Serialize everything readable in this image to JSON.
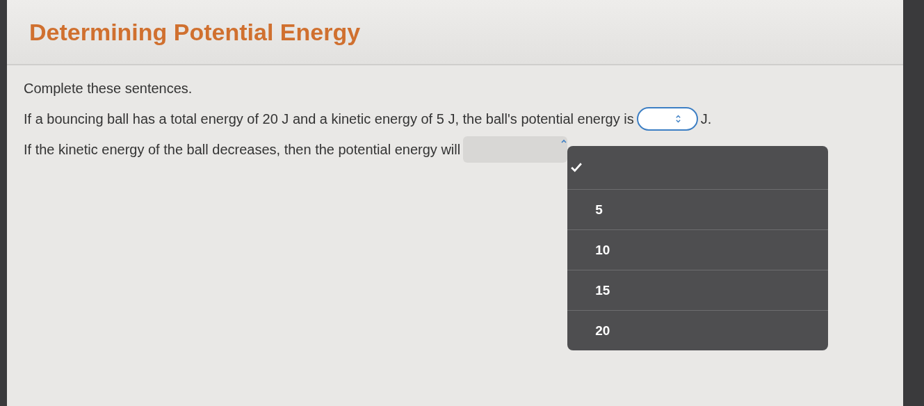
{
  "title": "Determining Potential Energy",
  "instructions": "Complete these sentences.",
  "sentences": [
    {
      "before": "If a bouncing ball has a total energy of 20 J and a kinetic energy of 5 J, the ball's potential energy is",
      "after": "J.",
      "dropdown": {
        "expanded": false
      }
    },
    {
      "before": "If the kinetic energy of the ball decreases, then the potential energy will",
      "dropdown": {
        "expanded": true
      }
    }
  ],
  "menu": {
    "blank_selected": true,
    "options": [
      {
        "label": "5",
        "selected": false
      },
      {
        "label": "10",
        "selected": false
      },
      {
        "label": "15",
        "selected": false
      },
      {
        "label": "20",
        "selected": false
      }
    ]
  }
}
